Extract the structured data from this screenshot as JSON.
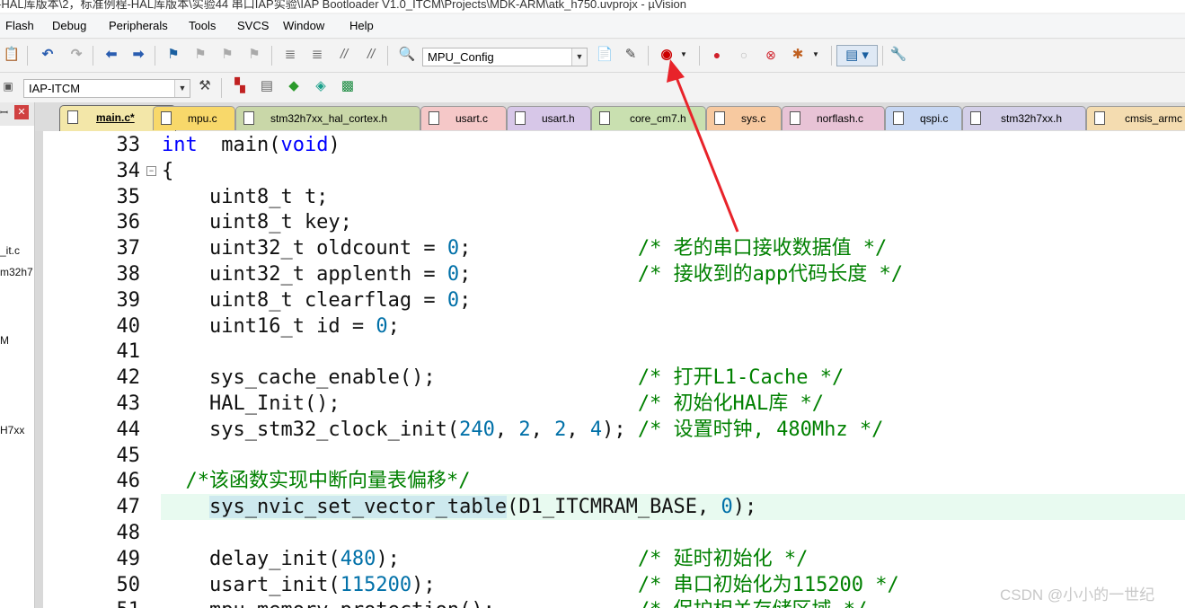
{
  "window": {
    "title": "-HAL库版本\\2，标准例程-HAL库版本\\实验44 串口IAP实验\\IAP Bootloader V1.0_ITCM\\Projects\\MDK-ARM\\atk_h750.uvprojx - µVision"
  },
  "menu": [
    "Flash",
    "Debug",
    "Peripherals",
    "Tools",
    "SVCS",
    "Window",
    "Help"
  ],
  "toolbar": {
    "config_combo": "MPU_Config",
    "target_combo": "IAP-ITCM"
  },
  "left_panel": {
    "items": [
      "_it.c",
      "m32h7",
      "M",
      "H7xx"
    ]
  },
  "tabs": [
    {
      "label": "main.c*",
      "active": true,
      "color": "#f3e7a9"
    },
    {
      "label": "mpu.c",
      "active": false,
      "color": "#f8d86a"
    },
    {
      "label": "stm32h7xx_hal_cortex.h",
      "active": false,
      "color": "#c9d7a8"
    },
    {
      "label": "usart.c",
      "active": false,
      "color": "#f5c8c8"
    },
    {
      "label": "usart.h",
      "active": false,
      "color": "#d7c7e8"
    },
    {
      "label": "core_cm7.h",
      "active": false,
      "color": "#c9e0b0"
    },
    {
      "label": "sys.c",
      "active": false,
      "color": "#f7c9a0"
    },
    {
      "label": "norflash.c",
      "active": false,
      "color": "#e8c3d6"
    },
    {
      "label": "qspi.c",
      "active": false,
      "color": "#c6d6f2"
    },
    {
      "label": "stm32h7xx.h",
      "active": false,
      "color": "#d3cfe8"
    },
    {
      "label": "cmsis_armc",
      "active": false,
      "color": "#f4dcb0"
    }
  ],
  "code": {
    "lines": [
      {
        "n": "33",
        "parts": [
          [
            "kw",
            "int"
          ],
          [
            "",
            "  main("
          ],
          [
            "kw",
            "void"
          ],
          [
            "",
            ")"
          ]
        ]
      },
      {
        "n": "34",
        "parts": [
          [
            "",
            "{"
          ]
        ]
      },
      {
        "n": "35",
        "parts": [
          [
            "",
            "    uint8_t t;"
          ]
        ]
      },
      {
        "n": "36",
        "parts": [
          [
            "",
            "    uint8_t key;"
          ]
        ]
      },
      {
        "n": "37",
        "parts": [
          [
            "",
            "    uint32_t oldcount = "
          ],
          [
            "num",
            "0"
          ],
          [
            "",
            ";              "
          ],
          [
            "cmt",
            "/* 老的串口接收数据值 */"
          ]
        ]
      },
      {
        "n": "38",
        "parts": [
          [
            "",
            "    uint32_t applenth = "
          ],
          [
            "num",
            "0"
          ],
          [
            "",
            ";              "
          ],
          [
            "cmt",
            "/* 接收到的app代码长度 */"
          ]
        ]
      },
      {
        "n": "39",
        "parts": [
          [
            "",
            "    uint8_t clearflag = "
          ],
          [
            "num",
            "0"
          ],
          [
            "",
            ";"
          ]
        ]
      },
      {
        "n": "40",
        "parts": [
          [
            "",
            "    uint16_t id = "
          ],
          [
            "num",
            "0"
          ],
          [
            "",
            ";"
          ]
        ]
      },
      {
        "n": "41",
        "parts": [
          [
            "",
            ""
          ]
        ]
      },
      {
        "n": "42",
        "parts": [
          [
            "",
            "    sys_cache_enable();                 "
          ],
          [
            "cmt",
            "/* 打开L1-Cache */"
          ]
        ]
      },
      {
        "n": "43",
        "parts": [
          [
            "",
            "    HAL_Init();                         "
          ],
          [
            "cmt",
            "/* 初始化HAL库 */"
          ]
        ]
      },
      {
        "n": "44",
        "parts": [
          [
            "",
            "    sys_stm32_clock_init("
          ],
          [
            "num",
            "240"
          ],
          [
            "",
            ", "
          ],
          [
            "num",
            "2"
          ],
          [
            "",
            ", "
          ],
          [
            "num",
            "2"
          ],
          [
            "",
            ", "
          ],
          [
            "num",
            "4"
          ],
          [
            "",
            "); "
          ],
          [
            "cmt",
            "/* 设置时钟, 480Mhz */"
          ]
        ]
      },
      {
        "n": "45",
        "parts": [
          [
            "",
            ""
          ]
        ]
      },
      {
        "n": "46",
        "parts": [
          [
            "cmt",
            "  /*该函数实现中断向量表偏移*/"
          ]
        ]
      },
      {
        "n": "47",
        "parts": [
          [
            "",
            "    "
          ],
          [
            "hw",
            "sys_nvic_set_vector_table"
          ],
          [
            "",
            "(D1_ITCMRAM_BASE, "
          ],
          [
            "num",
            "0"
          ],
          [
            "",
            ");"
          ]
        ]
      },
      {
        "n": "48",
        "parts": [
          [
            "",
            ""
          ]
        ]
      },
      {
        "n": "49",
        "parts": [
          [
            "",
            "    delay_init("
          ],
          [
            "num",
            "480"
          ],
          [
            "",
            ");                    "
          ],
          [
            "cmt",
            "/* 延时初始化 */"
          ]
        ]
      },
      {
        "n": "50",
        "parts": [
          [
            "",
            "    usart_init("
          ],
          [
            "num",
            "115200"
          ],
          [
            "",
            ");                 "
          ],
          [
            "cmt",
            "/* 串口初始化为115200 */"
          ]
        ]
      },
      {
        "n": "51",
        "parts": [
          [
            "",
            "    mpu_memory_protection();            "
          ],
          [
            "cmt",
            "/* 保护相关存储区域 */"
          ]
        ]
      }
    ]
  },
  "watermark": "CSDN @小小的一世纪"
}
